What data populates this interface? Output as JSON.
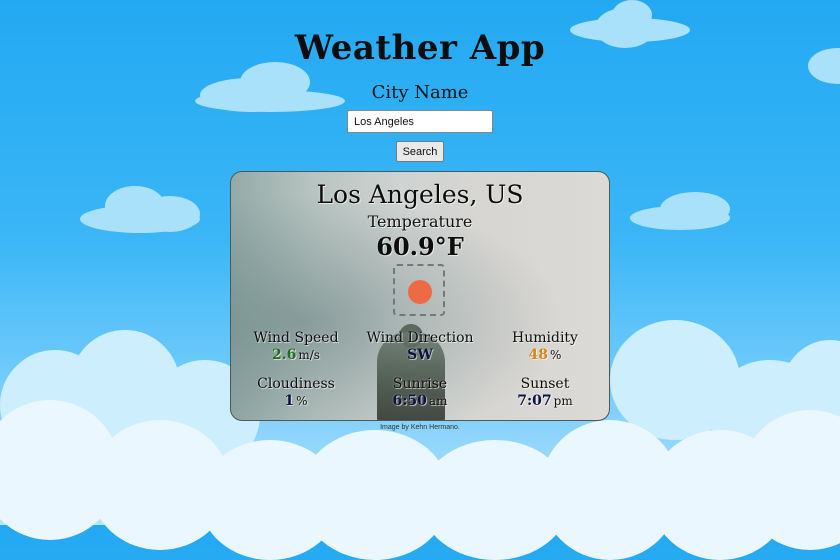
{
  "app": {
    "title": "Weather App",
    "city_label": "City Name",
    "search_value": "Los Angeles",
    "search_button": "Search"
  },
  "weather": {
    "location": "Los Angeles, US",
    "temperature_label": "Temperature",
    "temperature_value": "60.9°F",
    "condition_icon": "sun-icon",
    "stats": {
      "wind_speed": {
        "label": "Wind Speed",
        "value": "2.6",
        "unit": "m/s"
      },
      "wind_direction": {
        "label": "Wind Direction",
        "value": "SW"
      },
      "humidity": {
        "label": "Humidity",
        "value": "48",
        "unit": "%"
      },
      "cloudiness": {
        "label": "Cloudiness",
        "value": "1",
        "unit": "%"
      },
      "sunrise": {
        "label": "Sunrise",
        "value": "6:50",
        "unit": "am"
      },
      "sunset": {
        "label": "Sunset",
        "value": "7:07",
        "unit": "pm"
      }
    }
  },
  "footer": {
    "credit": "Image by Kehn Hermano."
  },
  "colors": {
    "sky": "#23a9f2",
    "sun_icon": "#ee6a45",
    "wind_speed_value": "#1f6e1f",
    "humidity_value": "#d98616"
  }
}
